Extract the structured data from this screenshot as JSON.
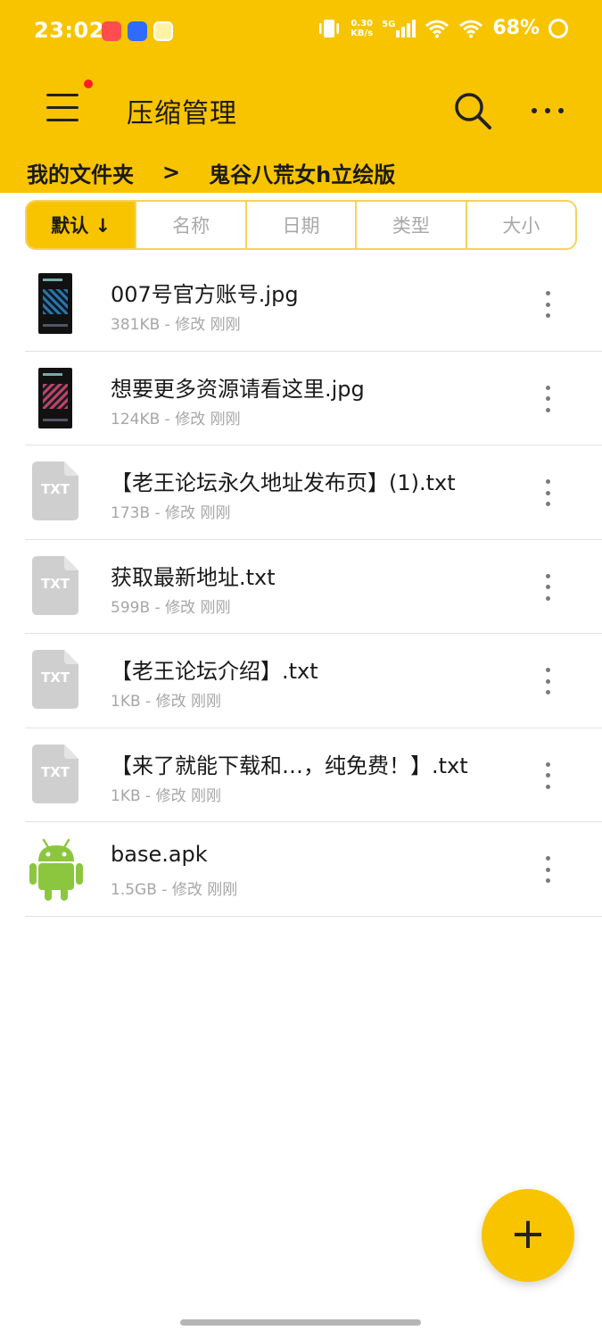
{
  "status_bar": {
    "time": "23:02",
    "speed_value": "0.30",
    "speed_unit": "KB/s",
    "network": "5G",
    "battery": "68%"
  },
  "app_bar": {
    "title": "压缩管理",
    "menu_icon": "hamburger-menu-icon",
    "search_icon": "search-icon",
    "more_icon": "more-horizontal-icon",
    "accent_color": "#f8c400",
    "badge_color": "#ff1f1f"
  },
  "breadcrumb": {
    "root": "我的文件夹",
    "separator": ">",
    "current": "鬼谷八荒女h立绘版"
  },
  "sort_tabs": [
    {
      "label": "默认 ↓",
      "active": true
    },
    {
      "label": "名称",
      "active": false
    },
    {
      "label": "日期",
      "active": false
    },
    {
      "label": "类型",
      "active": false
    },
    {
      "label": "大小",
      "active": false
    }
  ],
  "files": [
    {
      "name": "007号官方账号.jpg",
      "meta": "381KB - 修改 刚刚",
      "icon": "image-thumbnail"
    },
    {
      "name": "想要更多资源请看这里.jpg",
      "meta": "124KB - 修改 刚刚",
      "icon": "image-thumbnail"
    },
    {
      "name": "【老王论坛永久地址发布页】(1).txt",
      "meta": "173B - 修改 刚刚",
      "icon": "txt-file-icon",
      "icon_label": "TXT"
    },
    {
      "name": "获取最新地址.txt",
      "meta": "599B - 修改 刚刚",
      "icon": "txt-file-icon",
      "icon_label": "TXT"
    },
    {
      "name": "【老王论坛介绍】.txt",
      "meta": "1KB - 修改 刚刚",
      "icon": "txt-file-icon",
      "icon_label": "TXT"
    },
    {
      "name": "【来了就能下载和…，纯免费！】.txt",
      "meta": "1KB - 修改 刚刚",
      "icon": "txt-file-icon",
      "icon_label": "TXT"
    },
    {
      "name": "base.apk",
      "meta": "1.5GB - 修改 刚刚",
      "icon": "android-apk-icon"
    }
  ],
  "fab": {
    "label": "+",
    "icon": "plus-icon"
  }
}
